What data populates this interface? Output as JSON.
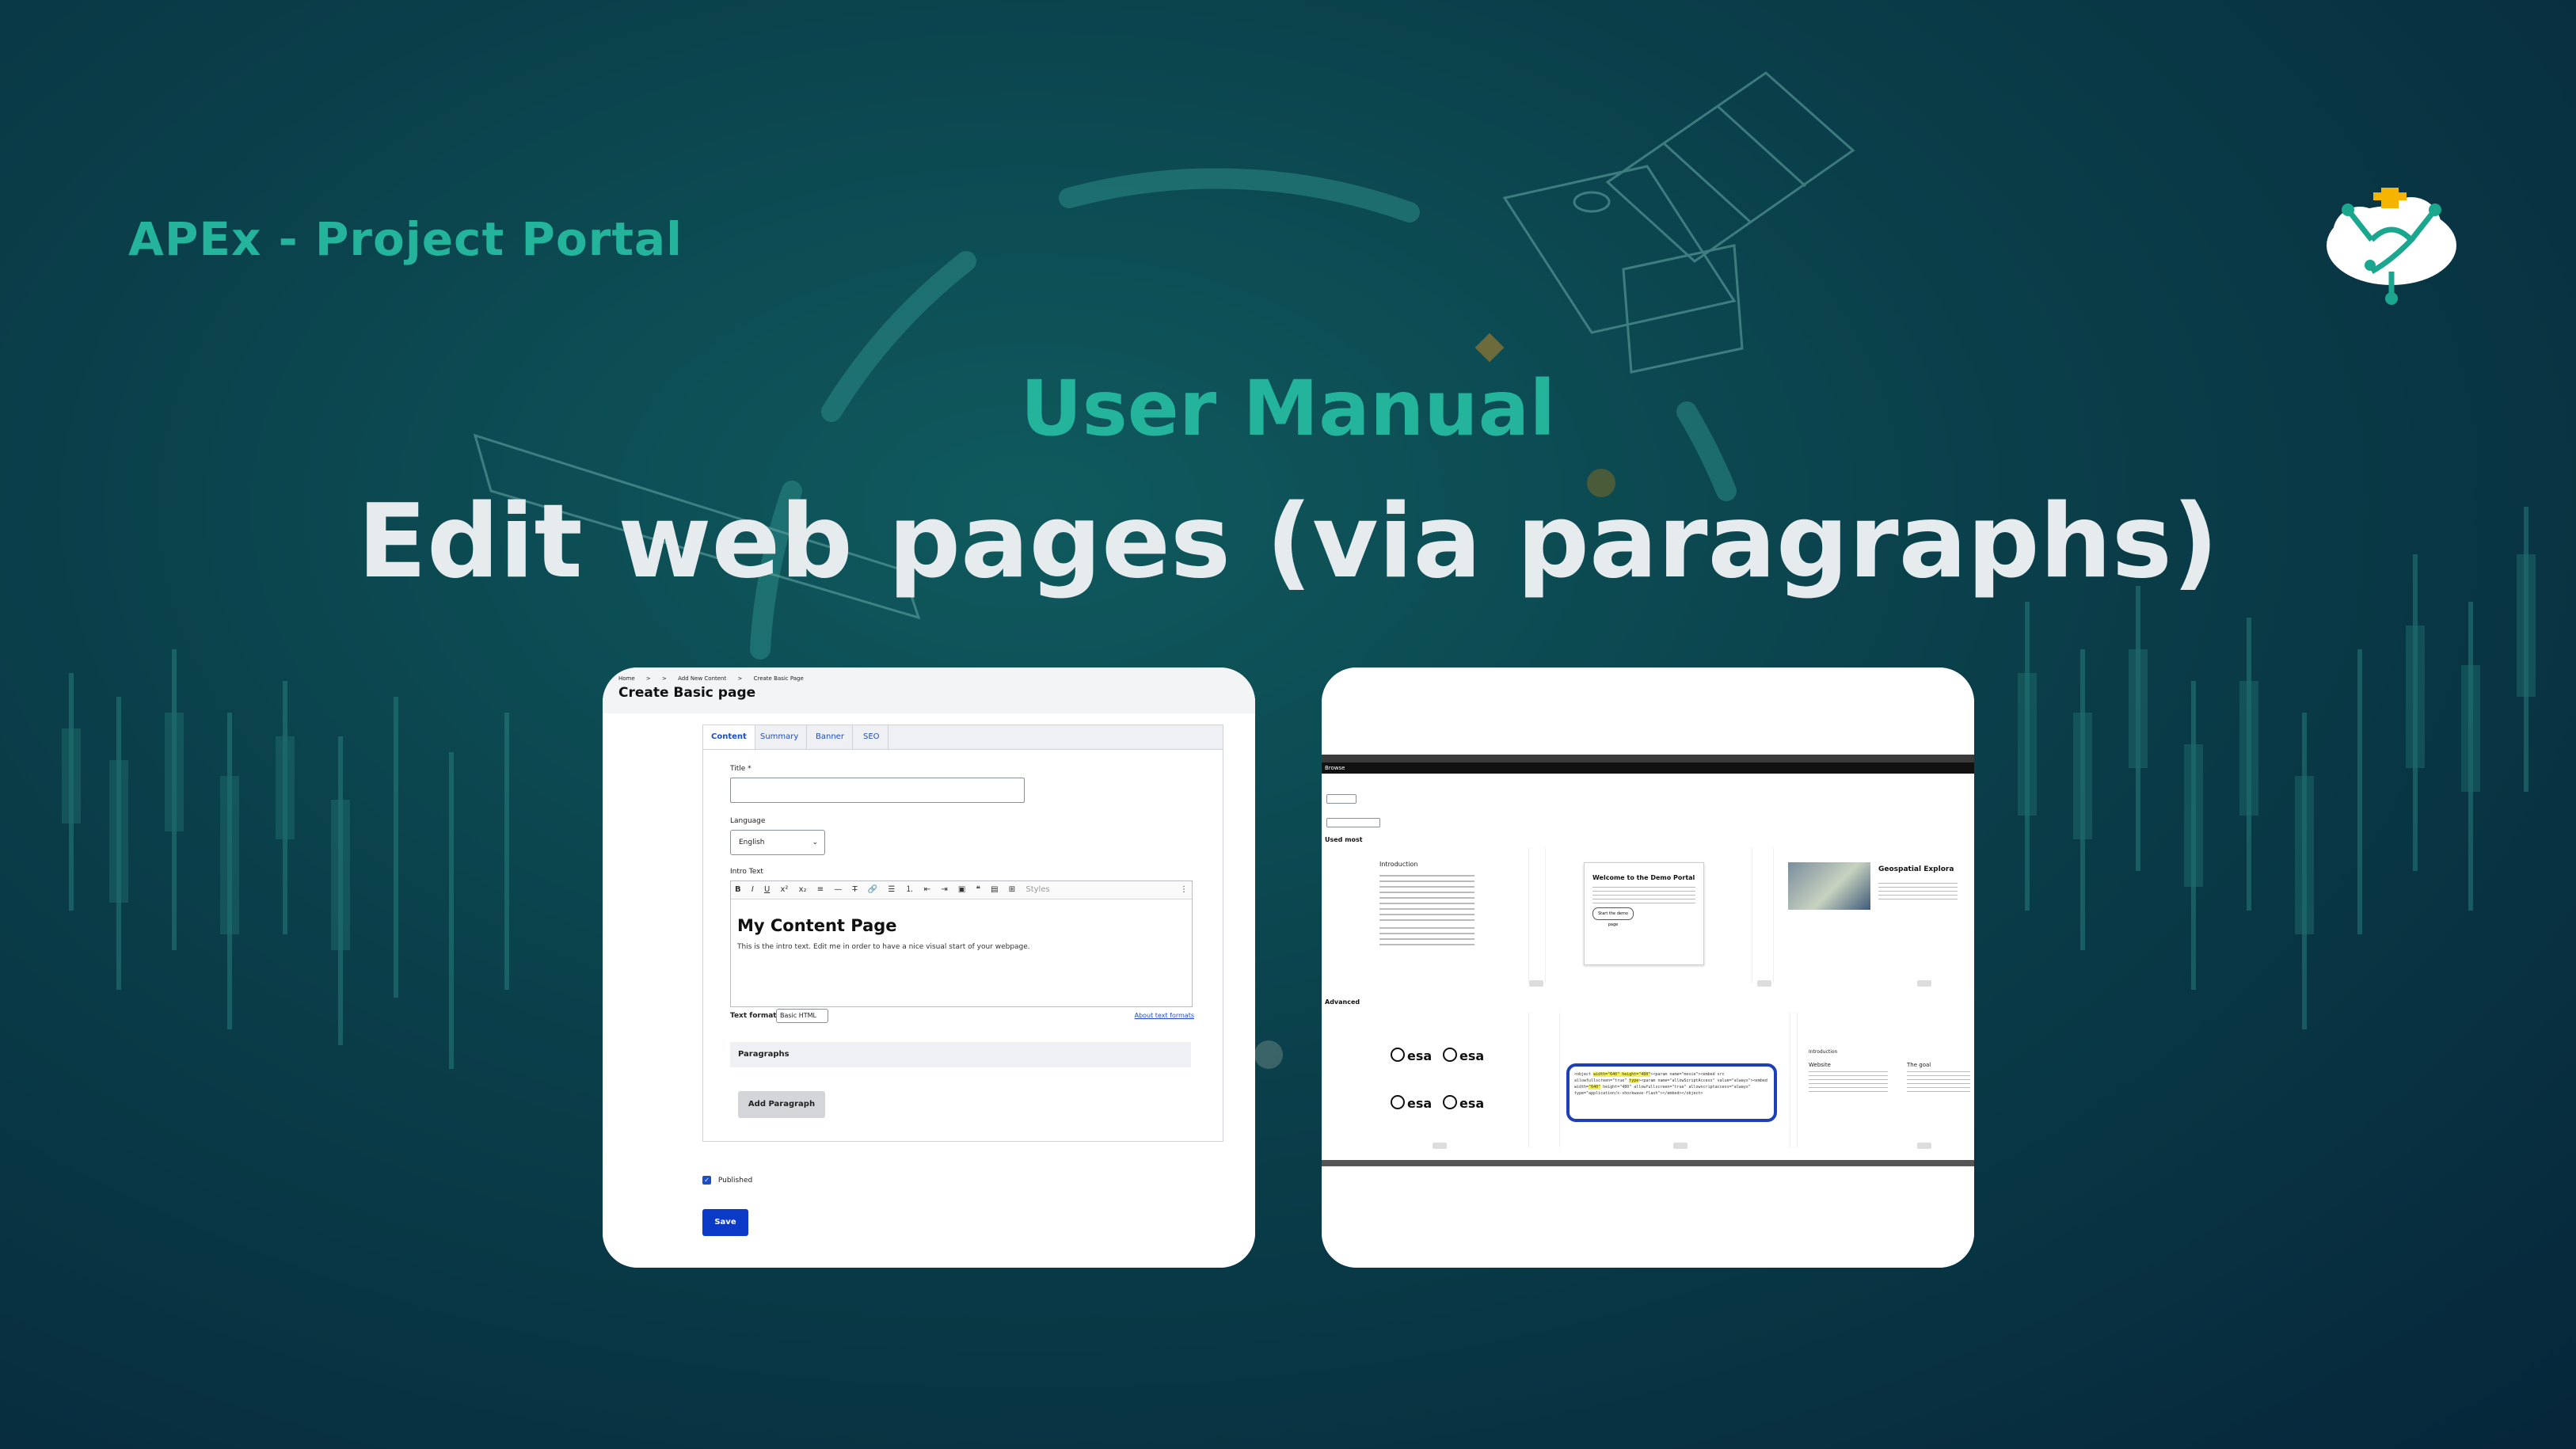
{
  "brand": {
    "title": "APEx - Project Portal"
  },
  "slide": {
    "subtitle": "User Manual",
    "headline": "Edit web pages (via paragraphs)"
  },
  "create_page": {
    "breadcrumb": [
      "Home",
      ">",
      ">",
      "Add New Content",
      ">",
      "Create Basic Page"
    ],
    "title": "Create Basic page",
    "tabs": [
      "Content",
      "Summary",
      "Banner",
      "SEO"
    ],
    "fields": {
      "title_label": "Title *",
      "language_label": "Language",
      "language_value": "English",
      "intro_label": "Intro Text",
      "editor_heading": "My Content Page",
      "editor_body": "This is the intro text. Edit me in order to have a nice visual start of your webpage.",
      "editor_styles": "Styles",
      "text_format_label": "Text format",
      "text_format_value": "Basic HTML",
      "about_formats": "About text formats",
      "paragraphs_label": "Paragraphs",
      "add_paragraph": "Add Paragraph",
      "published_label": "Published",
      "save_label": "Save"
    }
  },
  "browser": {
    "header": "Browse",
    "sections": {
      "used_most": "Used most",
      "advanced": "Advanced"
    },
    "cards": {
      "intro": "Introduction",
      "welcome_title": "Welcome to the Demo Portal",
      "welcome_button": "Start the demo page",
      "geo_title": "Geospatial Explora",
      "intro2": "Introduction",
      "website": "Website",
      "the_goal": "The goal"
    },
    "esa": "esa"
  },
  "colors": {
    "accent": "#24b39b",
    "headline": "#e6ecee",
    "primary_button": "#0b3bc6"
  }
}
